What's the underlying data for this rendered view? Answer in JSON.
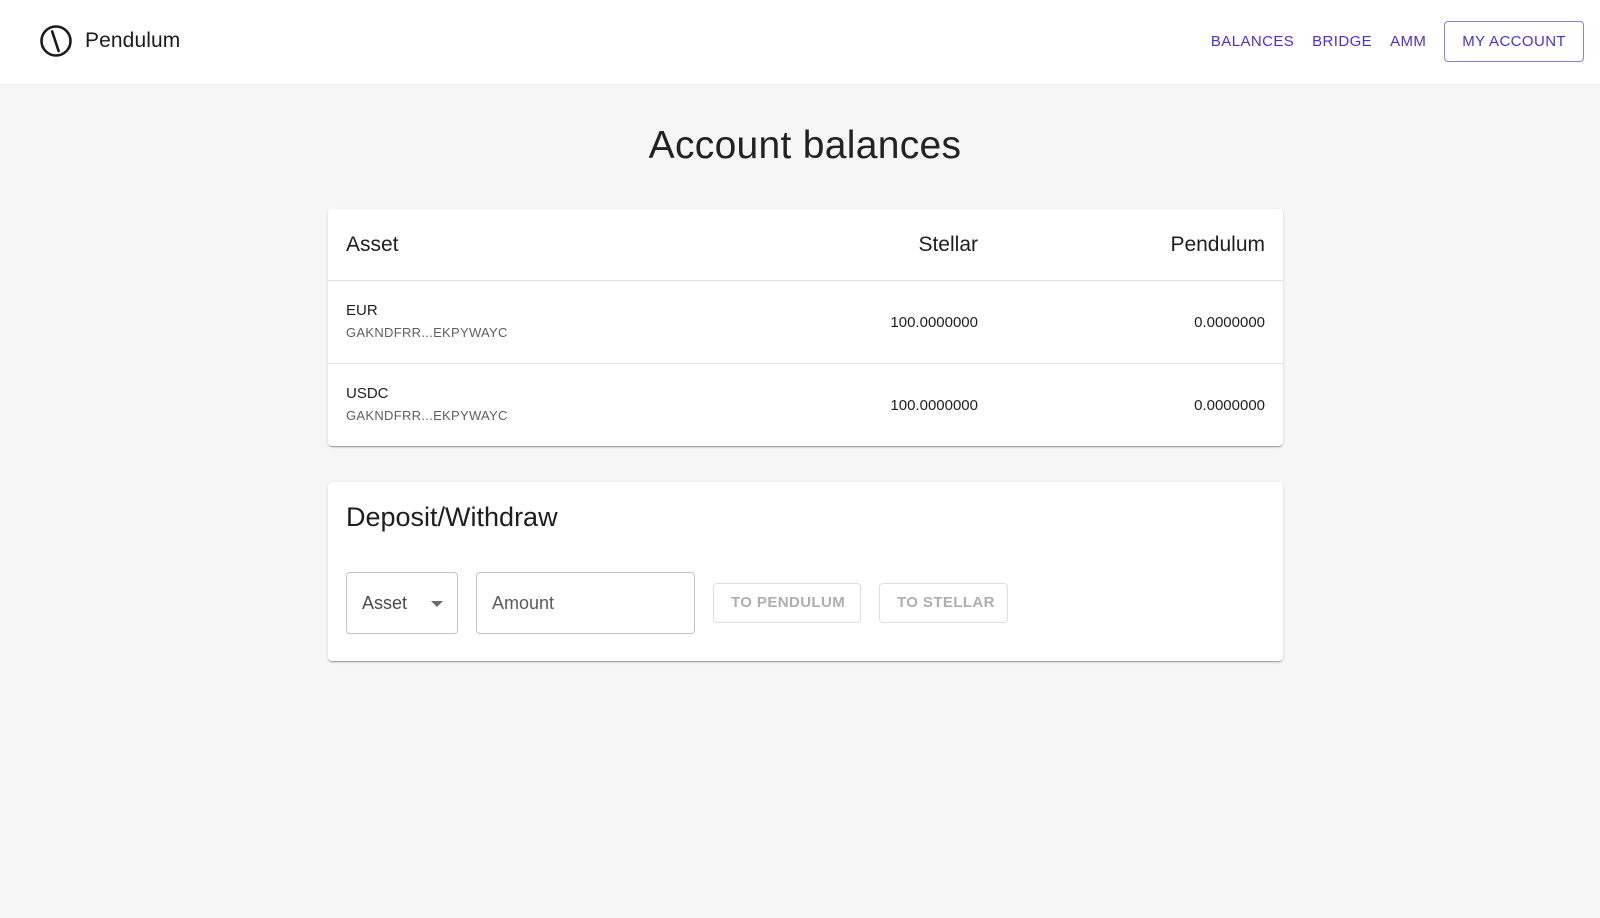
{
  "app": {
    "name": "Pendulum",
    "logo_icon": "pendulum-logo-icon"
  },
  "nav": {
    "balances": "BALANCES",
    "bridge": "BRIDGE",
    "amm": "AMM",
    "account": "MY ACCOUNT",
    "accent_color": "#4b2fd6"
  },
  "page": {
    "title": "Account balances"
  },
  "balances": {
    "headers": {
      "asset": "Asset",
      "stellar": "Stellar",
      "pendulum": "Pendulum"
    },
    "rows": [
      {
        "code": "EUR",
        "issuer": "GAKNDFRR...EKPYWAYC",
        "stellar": "100.0000000",
        "pendulum": "0.0000000"
      },
      {
        "code": "USDC",
        "issuer": "GAKNDFRR...EKPYWAYC",
        "stellar": "100.0000000",
        "pendulum": "0.0000000"
      }
    ]
  },
  "deposit": {
    "title": "Deposit/Withdraw",
    "asset_select": {
      "label": "Asset",
      "icon": "dropdown-arrow-icon"
    },
    "amount": {
      "placeholder": "Amount",
      "value": ""
    },
    "to_pendulum_label": "TO PENDULUM",
    "to_stellar_label": "TO STELLAR"
  }
}
